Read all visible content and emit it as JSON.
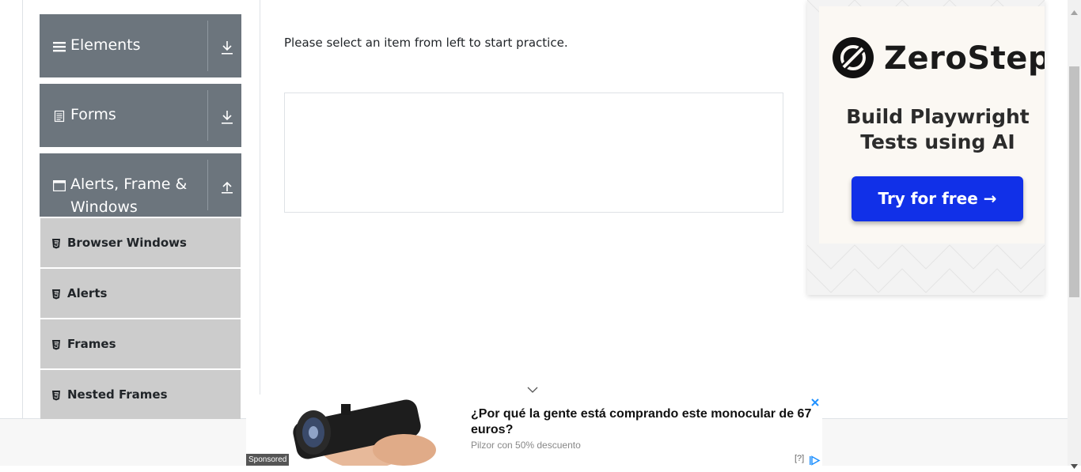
{
  "sidebar": {
    "groups": [
      {
        "title": "Elements",
        "icon": "hamburger-icon",
        "toggle": "expand-down-icon"
      },
      {
        "title": "Forms",
        "icon": "document-icon",
        "toggle": "expand-down-icon"
      },
      {
        "title": "Alerts, Frame & Windows",
        "icon": "window-icon",
        "toggle": "collapse-up-icon"
      }
    ],
    "items": [
      {
        "label": "Browser Windows",
        "icon": "html5-icon"
      },
      {
        "label": "Alerts",
        "icon": "html5-icon"
      },
      {
        "label": "Frames",
        "icon": "html5-icon"
      },
      {
        "label": "Nested Frames",
        "icon": "html5-icon"
      }
    ]
  },
  "main": {
    "instruction": "Please select an item from left to start practice."
  },
  "side_ad": {
    "brand": "ZeroStep",
    "tagline": "Build Playwright Tests using AI",
    "cta": "Try for free →",
    "cta_color": "#1130e8"
  },
  "bottom_ad": {
    "badge": "Sponsored",
    "headline": "¿Por qué la gente está comprando este monocular de 67 euros?",
    "source": "Pilzor con 50% descuento",
    "help": "[?]"
  },
  "colors": {
    "group_header": "#6c757d",
    "menu_item": "#cccccc",
    "ad_choices": "#1e90ff"
  }
}
